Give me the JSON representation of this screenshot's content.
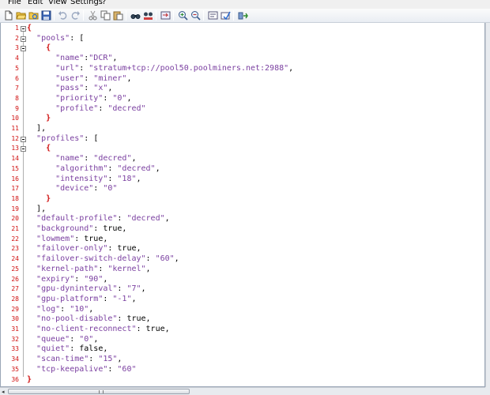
{
  "menu": {
    "file": "File",
    "edit": "Edit",
    "view": "View",
    "settings": "Settings",
    "help": "?"
  },
  "toolbar": {
    "buttons": [
      "new-file-icon",
      "open-folder-icon",
      "reload-icon",
      "save-icon",
      "undo-icon",
      "redo-icon",
      "cut-icon",
      "copy-icon",
      "paste-icon",
      "find-icon",
      "replace-icon",
      "goto-icon",
      "zoom-in-icon",
      "zoom-out-icon",
      "word-wrap-icon",
      "settings-icon",
      "run-icon"
    ]
  },
  "editor": {
    "line_numbers": [
      "1",
      "2",
      "3",
      "4",
      "5",
      "6",
      "7",
      "8",
      "9",
      "10",
      "11",
      "12",
      "13",
      "14",
      "15",
      "16",
      "17",
      "18",
      "19",
      "20",
      "21",
      "22",
      "23",
      "24",
      "25",
      "26",
      "27",
      "28",
      "29",
      "30",
      "31",
      "32",
      "33",
      "34",
      "35",
      "36"
    ],
    "lines": [
      "{",
      "  \"pools\": [",
      "    {",
      "      \"name\":\"DCR\",",
      "      \"url\": \"stratum+tcp://pool50.poolminers.net:2988\",",
      "      \"user\": \"miner\",",
      "      \"pass\": \"x\",",
      "      \"priority\": \"0\",",
      "      \"profile\": \"decred\"",
      "    }",
      "  ],",
      "  \"profiles\": [",
      "    {",
      "      \"name\": \"decred\",",
      "      \"algorithm\": \"decred\",",
      "      \"intensity\": \"18\",",
      "      \"device\": \"0\"",
      "    }",
      "  ],",
      "  \"default-profile\": \"decred\",",
      "  \"background\": true,",
      "  \"lowmem\": true,",
      "  \"failover-only\": true,",
      "  \"failover-switch-delay\": \"60\",",
      "  \"kernel-path\": \"kernel\",",
      "  \"expiry\": \"90\",",
      "  \"gpu-dyninterval\": \"7\",",
      "  \"gpu-platform\": \"-1\",",
      "  \"log\": \"10\",",
      "  \"no-pool-disable\": true,",
      "  \"no-client-reconnect\": true,",
      "  \"queue\": \"0\",",
      "  \"quiet\": false,",
      "  \"scan-time\": \"15\",",
      "  \"tcp-keepalive\": \"60\"",
      "}"
    ]
  },
  "colors": {
    "line_number": "#d01010",
    "string": "#7a3fa0",
    "brace": "#d01010"
  }
}
